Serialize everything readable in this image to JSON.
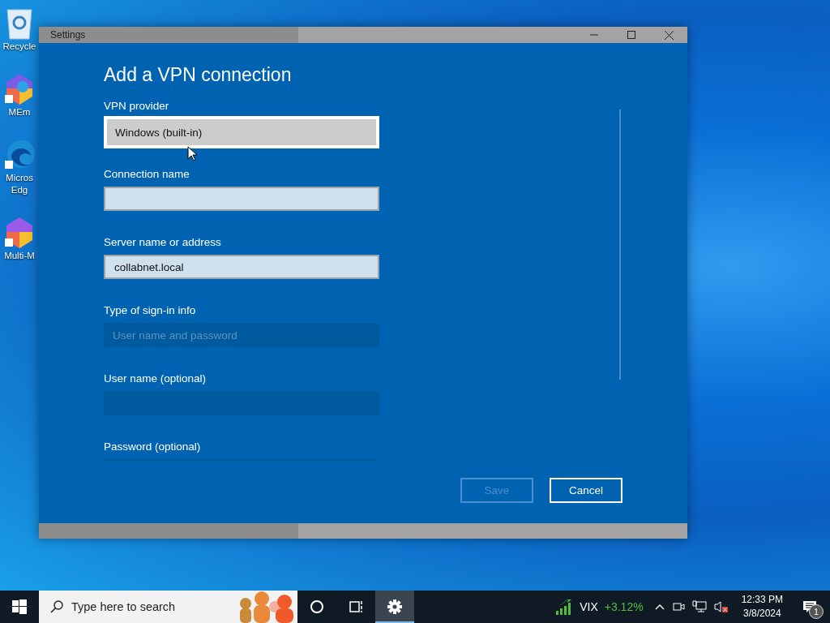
{
  "desktop_icons": [
    {
      "kind": "recycle",
      "lines": [
        "Recycle"
      ]
    },
    {
      "kind": "memu",
      "lines": [
        "MEm"
      ]
    },
    {
      "kind": "edge",
      "lines": [
        "Micros",
        "Edg"
      ]
    },
    {
      "kind": "multi",
      "lines": [
        "Multi-M"
      ]
    }
  ],
  "window": {
    "title": "Settings",
    "heading": "Add a VPN connection",
    "fields": [
      {
        "label": "VPN provider",
        "kind": "dropdown",
        "value": "Windows (built-in)",
        "disabled": false
      },
      {
        "label": "Connection name",
        "kind": "text",
        "disabled": false
      },
      {
        "label": "Server name or address",
        "kind": "text",
        "value": "collabnet.local",
        "disabled": false
      },
      {
        "label": "Type of sign-in info",
        "kind": "dropdown",
        "value": "User name and password",
        "disabled": true
      },
      {
        "label": "User name (optional)",
        "kind": "text",
        "disabled": true
      },
      {
        "label": "Password (optional)",
        "kind": "text",
        "disabled": true
      }
    ],
    "buttons": [
      {
        "label": "Save",
        "disabled": true
      },
      {
        "label": "Cancel",
        "disabled": false
      }
    ]
  },
  "taskbar": {
    "search_placeholder": "Type here to search",
    "apps": [
      {
        "kind": "cortana",
        "selected": false
      },
      {
        "kind": "taskview",
        "selected": false
      },
      {
        "kind": "settings",
        "selected": true
      }
    ],
    "stock": {
      "symbol": "VIX",
      "change": "+3.12%"
    },
    "clock": {
      "time": "12:33 PM",
      "date": "3/8/2024"
    },
    "notification_count": "1"
  }
}
